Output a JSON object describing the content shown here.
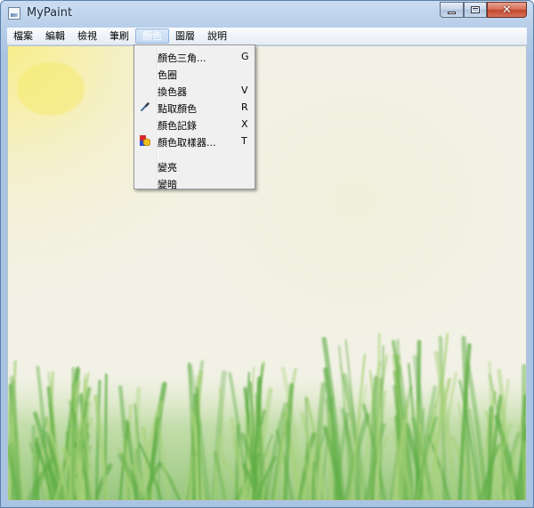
{
  "window": {
    "title": "MyPaint",
    "app_icon": "mypaint-app-icon"
  },
  "controls": {
    "minimize_icon": "minimize-icon",
    "maximize_icon": "maximize-icon",
    "close_glyph": "✕"
  },
  "menubar": {
    "items": [
      {
        "label": "檔案"
      },
      {
        "label": "編輯"
      },
      {
        "label": "檢視"
      },
      {
        "label": "筆刷"
      },
      {
        "label": "顏色"
      },
      {
        "label": "圖層"
      },
      {
        "label": "說明"
      }
    ],
    "active_index": 4
  },
  "color_menu": {
    "items": [
      {
        "label": "顏色三角...",
        "shortcut": "G"
      },
      {
        "label": "色圈",
        "shortcut": ""
      },
      {
        "label": "換色器",
        "shortcut": "V"
      },
      {
        "label": "點取顏色",
        "shortcut": "R",
        "icon": "eyedropper-icon"
      },
      {
        "label": "顏色記錄",
        "shortcut": "X"
      },
      {
        "label": "顏色取樣器...",
        "shortcut": "T",
        "icon": "color-sampler-icon"
      },
      {
        "label": "變亮",
        "shortcut": ""
      },
      {
        "label": "變暗",
        "shortcut": ""
      }
    ]
  },
  "canvas": {
    "scene": "painting-sun-and-grass",
    "colors": {
      "background": "#f2f1e6",
      "sun": "#f7ec8a",
      "grass_light": "#a8d27a",
      "grass_dark": "#5fae45"
    }
  }
}
